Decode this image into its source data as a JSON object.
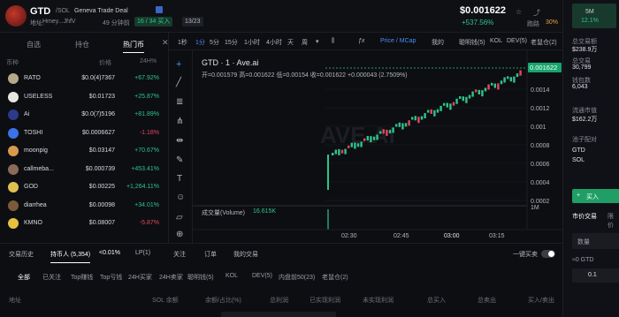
{
  "header": {
    "symbol": "GTD",
    "chain": "/SOL",
    "name": "Geneva Trade Deal",
    "address_label": "地址:",
    "address": "Hmey...JhfV",
    "age": "49 分钟前",
    "buy_count": "16 / 34 买入",
    "holders": "13/23",
    "price": "$0.001622",
    "price_change": "+537.56%",
    "stat_label": "跑路",
    "stat_value": "30%"
  },
  "left": {
    "tabs": [
      "自选",
      "持仓",
      "热门币"
    ],
    "col_coin": "币种",
    "col_price": "价格",
    "col_change": "24H%",
    "rows": [
      {
        "name": "RATO",
        "price": "$0.0(4)7367",
        "change": "+67.92%",
        "dir": "up",
        "color": "#b5a98a"
      },
      {
        "name": "USELESS",
        "price": "$0.01723",
        "change": "+25.87%",
        "dir": "up",
        "color": "#e8e6e0"
      },
      {
        "name": "Ai",
        "price": "$0.0(7)5196",
        "change": "+81.89%",
        "dir": "up",
        "color": "#2b3a8a"
      },
      {
        "name": "TOSHI",
        "price": "$0.0006627",
        "change": "-1.18%",
        "dir": "dn",
        "color": "#3b72e8"
      },
      {
        "name": "moonpig",
        "price": "$0.03147",
        "change": "+70.67%",
        "dir": "up",
        "color": "#d89a4a"
      },
      {
        "name": "callmeba...",
        "price": "$0.000739",
        "change": "+453.41%",
        "dir": "up",
        "color": "#8a6a5a"
      },
      {
        "name": "GOD",
        "price": "$0.00225",
        "change": "+1,264.11%",
        "dir": "up",
        "color": "#e0c050"
      },
      {
        "name": "diarrhea",
        "price": "$0.00098",
        "change": "+34.01%",
        "dir": "up",
        "color": "#7a5a3a"
      },
      {
        "name": "KMNO",
        "price": "$0.08007",
        "change": "-5.87%",
        "dir": "dn",
        "color": "#e8c040"
      }
    ]
  },
  "toolbar": {
    "intervals": [
      "1秒",
      "1分",
      "5分",
      "15分",
      "1小时",
      "4小时",
      "天",
      "周"
    ],
    "price_mcap": "Price / MCap",
    "mine": "我的",
    "smart": "聪明钱(5)",
    "kol": "KOL",
    "dev": "DEV(5)",
    "old": "老鼠仓(2)"
  },
  "chart": {
    "title": "GTD · 1 · Ave.ai",
    "ohlc": "开=0.001579 高=0.001622 低=0.00154 收=0.001622 +0.000043 (2.7509%)",
    "watermark": "AVE.AI",
    "last_price": "0.001622",
    "yticks": [
      "0.0014",
      "0.0012",
      "0.001",
      "0.0008",
      "0.0006",
      "0.0004",
      "0.0002"
    ],
    "xticks": [
      "02:30",
      "02:45",
      "03:00",
      "03:15"
    ],
    "volume_label": "成交量(Volume)",
    "volume_value": "16.615K",
    "vol_tick": "1M"
  },
  "right": {
    "mcap_label": "5M",
    "mcap_pct": "12.1%",
    "pool_label": "总交易额",
    "pool_value": "$238.9万",
    "tx_label": "总交易",
    "tx_value": "30,799",
    "wallet_label": "钱包数",
    "wallet_value": "6,043",
    "liq_label": "流通市值",
    "liq_value": "$162.2万",
    "pair_label": "池子配对",
    "pair_a": "GTD",
    "pair_b": "SOL",
    "buy_btn": "买入",
    "tab_market": "市价交易",
    "tab_limit": "限价",
    "qty_label": "数量",
    "bal": "≈0 GTD",
    "amt": "0.1"
  },
  "bottom": {
    "tabs": [
      "交易历史",
      "持币人 (5,354)",
      "<0.01%",
      "LP(1)",
      "关注",
      "订单",
      "我的交易"
    ],
    "hide_label": "一键买卖",
    "chips": [
      "全部",
      "已关注",
      "Top赚钱",
      "Top亏钱",
      "24H买家",
      "24H卖家",
      "聪明钱(5)",
      "KOL",
      "DEV(5)",
      "内盘前50(23)",
      "老鼠仓(2)"
    ],
    "cols": [
      "地址",
      "SOL 余额",
      "余额/占比(%)",
      "总利润",
      "已实现利润",
      "未实现利润",
      "总买入",
      "总卖出",
      "买入/卖出"
    ]
  }
}
